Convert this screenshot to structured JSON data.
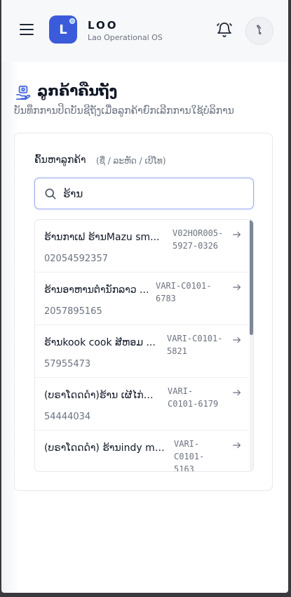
{
  "header": {
    "logo_letter": "L",
    "brand_name": "LOO",
    "brand_subtitle": "Lao Operational OS",
    "avatar_letter": "ໂ"
  },
  "page": {
    "title": "ລູກຄ້າຄືນຖັງ",
    "subtitle": "ບັນທຶກການປິດບັນຊີຖັງເມື່ອລູກຄ້າຍົກເລີກການໃຊ້ບໍລິການ"
  },
  "search": {
    "label": "ຄົ້ນຫາລູກຄ້າ",
    "hint": "(ຊື່ / ລະຫັດ / ເບີໂທ)",
    "value": "ຮ້ານ"
  },
  "results": [
    {
      "name": "ຮ້ານກາເຟ ຮ້ານMazu sm...",
      "code": "V02HOR005-\n5927-0326",
      "phone": "02054592357"
    },
    {
      "name": "ຮ້ານອາຫານຕຳນັກລາວ ...",
      "code": "VARI-C0101-\n6783",
      "phone": "2057895165"
    },
    {
      "name": "ຮ້ານkook cook ສີຫອມ ...",
      "code": "VARI-C0101-\n5821",
      "phone": "57955473"
    },
    {
      "name": "(ບຣາໂດດດຳ)ຮ້ານ ເຜີໄກ່ມາ...",
      "code": "VARI-\nC0101-6179",
      "phone": "54444034"
    },
    {
      "name": "(ບຣາໂດດດຳ) ຮ້ານindy mi...",
      "code": "VARI-\nC0101-\n5163",
      "phone": ""
    }
  ],
  "colors": {
    "accent": "#3b5bdb",
    "border_focus": "#9aa9f0"
  },
  "icons": [
    "menu-icon",
    "bell-icon",
    "customer-return-icon",
    "search-icon",
    "arrow-right-icon"
  ]
}
